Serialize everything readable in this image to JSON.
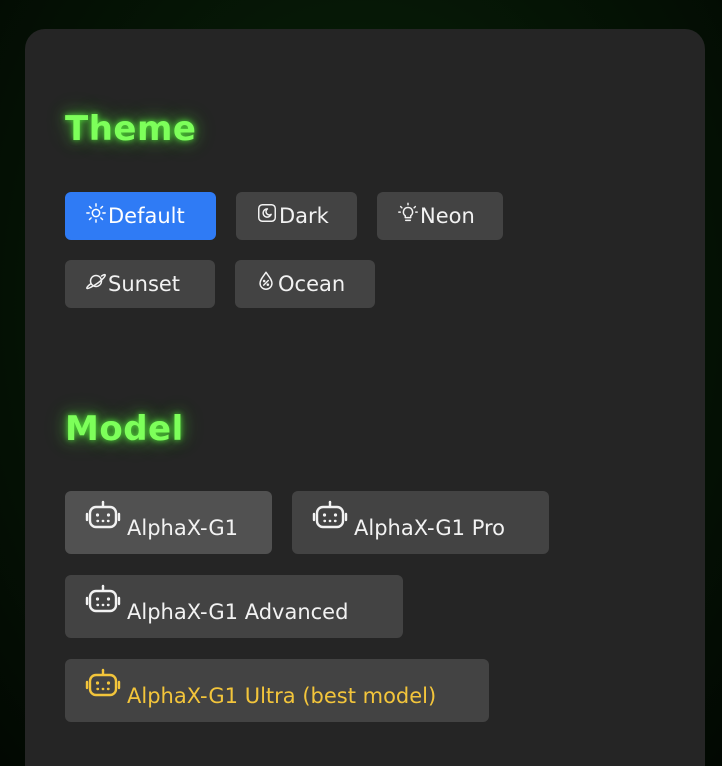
{
  "theme": {
    "title": "Theme",
    "options": [
      {
        "label": "Default",
        "icon": "sun-icon",
        "active": true
      },
      {
        "label": "Dark",
        "icon": "moon-card-icon",
        "active": false
      },
      {
        "label": "Neon",
        "icon": "lightbulb-icon",
        "active": false
      },
      {
        "label": "Sunset",
        "icon": "planet-icon",
        "active": false
      },
      {
        "label": "Ocean",
        "icon": "water-drop-icon",
        "active": false
      }
    ],
    "active_color": "#2f7bf5",
    "button_color": "#434343"
  },
  "model": {
    "title": "Model",
    "options": [
      {
        "label": "AlphaX-G1",
        "icon": "robot-icon",
        "selected": true
      },
      {
        "label": "AlphaX-G1 Pro",
        "icon": "robot-icon",
        "selected": false
      },
      {
        "label": "AlphaX-G1 Advanced",
        "icon": "robot-icon",
        "selected": false
      },
      {
        "label": "AlphaX-G1 Ultra (best model)",
        "icon": "robot-icon",
        "selected": false,
        "highlight_color": "#f3c53b"
      }
    ]
  },
  "colors": {
    "heading_glow": "#7dff5a",
    "panel": "#252525"
  }
}
